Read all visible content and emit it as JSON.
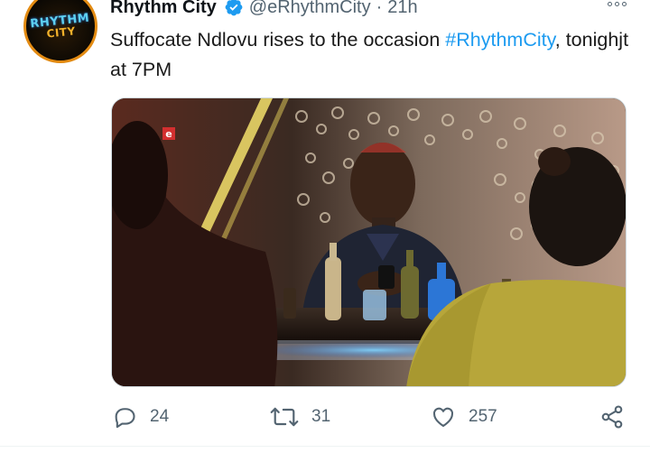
{
  "tweet": {
    "author": {
      "name": "Rhythm City",
      "handle": "@eRhythmCity",
      "verified": true,
      "avatar_text_line1": "RHYTHM",
      "avatar_text_line2": "CITY"
    },
    "separator": "·",
    "time": "21h",
    "more_icon": "more-dots-icon",
    "text_before": "Suffocate Ndlovu rises to the occasion ",
    "hashtag": "#RhythmCity",
    "text_after": ", tonighjt at 7PM",
    "media": {
      "watermark": "e",
      "accent_color": "#d32f2f"
    }
  },
  "actions": {
    "reply": {
      "icon": "reply-icon",
      "count": "24"
    },
    "retweet": {
      "icon": "retweet-icon",
      "count": "31"
    },
    "like": {
      "icon": "heart-icon",
      "count": "257"
    },
    "share": {
      "icon": "share-icon"
    }
  },
  "colors": {
    "link": "#1d9bf0",
    "muted": "#536471",
    "text": "#0f1419",
    "verified": "#1d9bf0",
    "avatar_ring": "#e38b12"
  }
}
